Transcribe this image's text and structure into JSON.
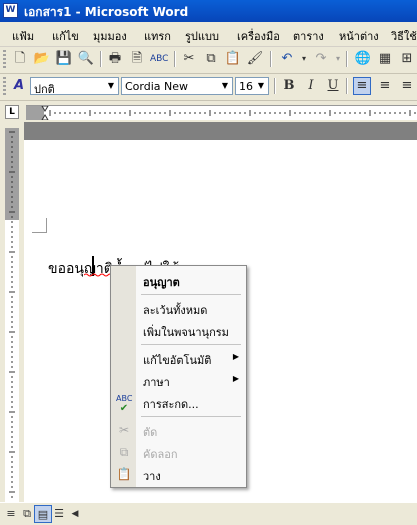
{
  "window": {
    "title": "เอกสาร1 - Microsoft Word",
    "app_icon": "word-document-icon"
  },
  "menubar": {
    "items": [
      {
        "label": "แฟ้ม"
      },
      {
        "label": "แก้ไข"
      },
      {
        "label": "มุมมอง"
      },
      {
        "label": "แทรก"
      },
      {
        "label": "รูปแบบ"
      },
      {
        "label": "เครื่องมือ"
      },
      {
        "label": "ตาราง"
      },
      {
        "label": "หน้าต่าง"
      },
      {
        "label": "วิธีใช้"
      }
    ]
  },
  "formatting": {
    "style": "ปกติ",
    "font": "Cordia New",
    "size": "16",
    "bold": "B",
    "italic": "I",
    "underline": "U"
  },
  "document": {
    "text": "ขออนุญาติน้ำรูปไปใช้งานนะคะ"
  },
  "context_menu": {
    "items": [
      {
        "label": "อนุญาต",
        "bold": true
      },
      {
        "label": "ละเว้นทั้งหมด"
      },
      {
        "label": "เพิ่มในพจนานุกรม"
      },
      {
        "label": "แก้ไขอัตโนมัติ"
      },
      {
        "label": "ภาษา"
      },
      {
        "label": "การสะกด..."
      },
      {
        "label": "ตัด"
      },
      {
        "label": "คัดลอก"
      },
      {
        "label": "วาง"
      }
    ]
  },
  "colors": {
    "titlebar": "#0a5fd6",
    "menu_bg": "#ece9d8",
    "misspelling": "#ff0000"
  }
}
